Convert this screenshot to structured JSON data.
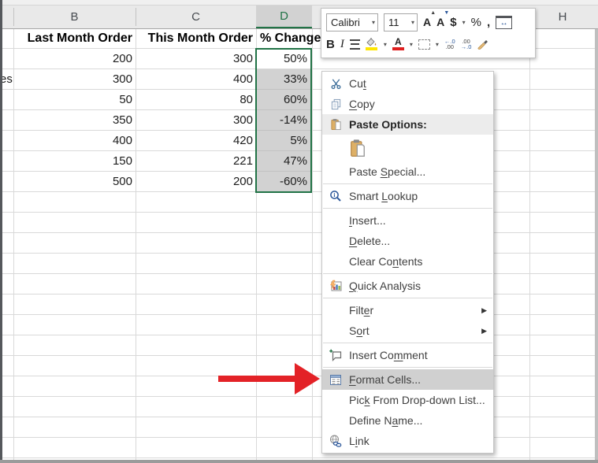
{
  "colors": {
    "excel_green": "#217346",
    "selection_fill": "#d2d2d2",
    "menu_highlight": "#d0d0d0",
    "arrow_red": "#e32227",
    "header_bg": "#e9e9e9"
  },
  "sheet": {
    "partial_label_col_a": "es",
    "column_letters": {
      "b": "B",
      "c": "C",
      "d": "D",
      "h": "H"
    },
    "selected_column": "D",
    "headers": [
      "Last Month Order",
      "This Month Order",
      "% Change"
    ],
    "rows": [
      [
        "200",
        "300",
        "50%"
      ],
      [
        "300",
        "400",
        "33%"
      ],
      [
        "50",
        "80",
        "60%"
      ],
      [
        "350",
        "300",
        "-14%"
      ],
      [
        "400",
        "420",
        "5%"
      ],
      [
        "150",
        "221",
        "47%"
      ],
      [
        "500",
        "200",
        "-60%"
      ]
    ]
  },
  "mini_toolbar": {
    "font_name": "Calibri",
    "font_size": "11",
    "bold": "B",
    "italic": "I",
    "grow_font": "A",
    "shrink_font": "A",
    "dollar": "$",
    "percent": "%",
    "comma": ",",
    "width_arrow": "↔",
    "inc_decimal_top": "←.0",
    "inc_decimal_bottom": ".00",
    "dec_decimal_top": ".00",
    "dec_decimal_bottom": "→.0"
  },
  "context_menu": {
    "items": {
      "cut": {
        "pre": "Cu",
        "key": "t",
        "post": ""
      },
      "copy": {
        "pre": "",
        "key": "C",
        "post": "opy"
      },
      "paste_options": {
        "label": "Paste Options:"
      },
      "paste_special": {
        "pre": "Paste ",
        "key": "S",
        "post": "pecial..."
      },
      "smart_lookup": {
        "pre": "Smart ",
        "key": "L",
        "post": "ookup"
      },
      "insert": {
        "pre": "",
        "key": "I",
        "post": "nsert..."
      },
      "delete": {
        "pre": "",
        "key": "D",
        "post": "elete..."
      },
      "clear_contents": {
        "pre": "Clear Co",
        "key": "n",
        "post": "tents"
      },
      "quick_analysis": {
        "pre": "",
        "key": "Q",
        "post": "uick Analysis"
      },
      "filter": {
        "pre": "Filt",
        "key": "e",
        "post": "r"
      },
      "sort": {
        "pre": "S",
        "key": "o",
        "post": "rt"
      },
      "insert_comment": {
        "pre": "Insert Co",
        "key": "m",
        "post": "ment"
      },
      "format_cells": {
        "pre": "",
        "key": "F",
        "post": "ormat Cells..."
      },
      "pick_from_list": {
        "pre": "Pic",
        "key": "k",
        "post": " From Drop-down List..."
      },
      "define_name": {
        "pre": "Define N",
        "key": "a",
        "post": "me..."
      },
      "link": {
        "pre": "L",
        "key": "i",
        "post": "nk"
      }
    },
    "submenu_arrow": "▶"
  }
}
